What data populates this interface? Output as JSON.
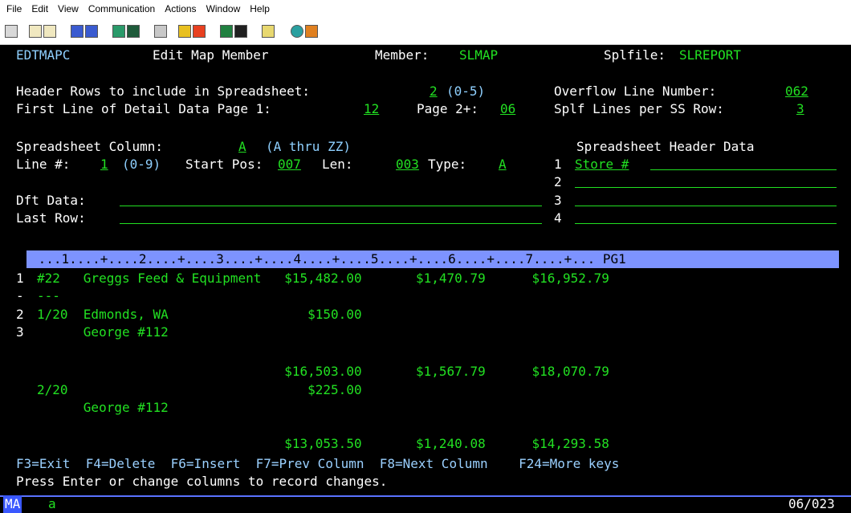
{
  "menu": [
    "File",
    "Edit",
    "View",
    "Communication",
    "Actions",
    "Window",
    "Help"
  ],
  "toolbar_icons": [
    "print-screen-icon",
    "copy-icon",
    "paste-icon",
    "send-icon",
    "receive-icon",
    "display-icon",
    "keyboard-icon",
    "macro-icon",
    "record-icon",
    "stop-icon",
    "play-icon",
    "macro2-icon",
    "clipboard-icon",
    "globe-icon",
    "edit-icon"
  ],
  "header": {
    "program": "EDTMAPC",
    "title": "Edit Map Member",
    "member_label": "Member:",
    "member_value": "SLMAP",
    "splf_label": "Splfile:",
    "splf_value": "SLREPORT"
  },
  "form": {
    "header_rows_label": "Header Rows to include in Spreadsheet:",
    "header_rows_value": "2",
    "header_rows_range": "(0-5)",
    "overflow_label": "Overflow Line Number:",
    "overflow_value": "062",
    "first_line_label": "First Line of Detail Data Page 1:",
    "first_line_value": "12",
    "page2_label": "Page 2+:",
    "page2_value": "06",
    "splf_lines_label": "Splf Lines per SS Row:",
    "splf_lines_value": "3",
    "ss_col_label": "Spreadsheet Column:",
    "ss_col_value": "A",
    "ss_col_range": "(A thru ZZ)",
    "ss_header_title": "Spreadsheet Header Data",
    "line_label": "Line #:",
    "line_value": "1",
    "line_range": "(0-9)",
    "start_label": "Start Pos:",
    "start_value": "007",
    "len_label": "Len:",
    "len_value": "003",
    "type_label": "Type:",
    "type_value": "A",
    "header_nums": [
      "1",
      "2",
      "3",
      "4"
    ],
    "header_data_1": "Store #",
    "dft_label": "Dft Data:",
    "last_row_label": "Last Row:"
  },
  "ruler": " ...1....+....2....+....3....+....4....+....5....+....6....+....7....+... PG1",
  "report": [
    {
      "num": "1",
      "text": "#22   Greggs Feed & Equipment   $15,482.00       $1,470.79      $16,952.79"
    },
    {
      "num": "-",
      "text": "---"
    },
    {
      "num": "2",
      "text": "1/20  Edmonds, WA                  $150.00"
    },
    {
      "num": "3",
      "text": "      George #112"
    },
    {
      "num": "",
      "text": ""
    },
    {
      "num": "",
      "text": "                                $16,503.00       $1,567.79      $18,070.79"
    },
    {
      "num": "",
      "text": "2/20                               $225.00"
    },
    {
      "num": "",
      "text": "      George #112"
    },
    {
      "num": "",
      "text": ""
    },
    {
      "num": "",
      "text": "                                $13,053.50       $1,240.08      $14,293.58"
    }
  ],
  "fkeys": "F3=Exit  F4=Delete  F6=Insert  F7=Prev Column  F8=Next Column    F24=More keys",
  "message": "Press Enter or change columns to record changes.",
  "status": {
    "mode": "MA",
    "indicator": "a",
    "position": "06/023"
  }
}
